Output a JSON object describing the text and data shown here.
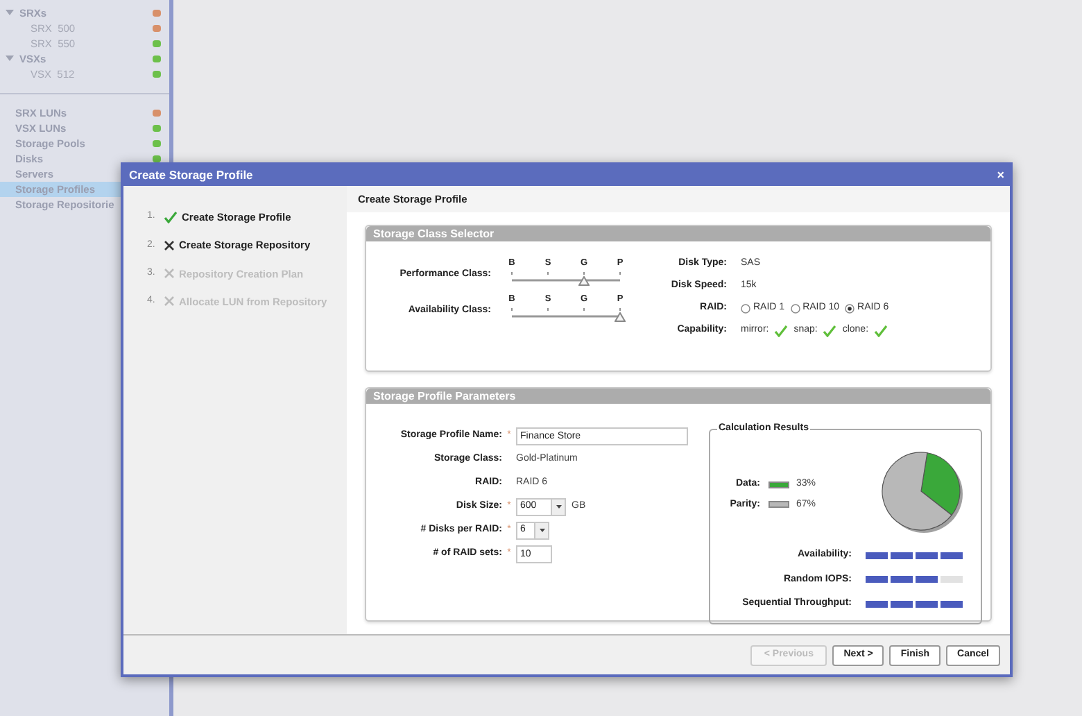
{
  "sidebar": {
    "tree": [
      {
        "label": "SRXs",
        "expanded": true,
        "color": "#d8906a",
        "children": [
          {
            "label": "SRX  500",
            "color": "#d8906a"
          },
          {
            "label": "SRX  550",
            "color": "#6cc04a"
          }
        ]
      },
      {
        "label": "VSXs",
        "expanded": true,
        "color": "#6cc04a",
        "children": [
          {
            "label": "VSX  512",
            "color": "#6cc04a"
          }
        ]
      }
    ],
    "items": [
      {
        "label": "SRX LUNs",
        "color": "#d8906a",
        "selected": false
      },
      {
        "label": "VSX LUNs",
        "color": "#6cc04a",
        "selected": false
      },
      {
        "label": "Storage Pools",
        "color": "#6cc04a",
        "selected": false
      },
      {
        "label": "Disks",
        "color": "#6cc04a",
        "selected": false
      },
      {
        "label": "Servers",
        "selected": false
      },
      {
        "label": "Storage Profiles",
        "selected": true
      },
      {
        "label": "Storage Repositorie",
        "selected": false
      }
    ]
  },
  "dialog": {
    "title": "Create Storage Profile",
    "close": "×",
    "steps": [
      {
        "number": "1.",
        "label": "Create Storage Profile",
        "completed": true,
        "active": false
      },
      {
        "number": "2.",
        "label": "Create Storage Repository",
        "completed": false,
        "active": true
      },
      {
        "number": "3.",
        "label": "Repository Creation Plan",
        "completed": false,
        "active": false
      },
      {
        "number": "4.",
        "label": "Allocate LUN from Repository",
        "completed": false,
        "active": false
      }
    ],
    "heading": "Create Storage Profile",
    "class_selector": {
      "title": "Storage Class Selector",
      "sliders": [
        {
          "label": "Performance Class:",
          "ticks": [
            "B",
            "S",
            "G",
            "P"
          ],
          "level": 0.67
        },
        {
          "label": "Availability Class:",
          "ticks": [
            "B",
            "S",
            "G",
            "P"
          ],
          "level": 1
        }
      ],
      "details": [
        {
          "kind": "text",
          "label": "Disk Type:",
          "value": "SAS"
        },
        {
          "kind": "text",
          "label": "Disk Speed:",
          "value": "15k"
        },
        {
          "kind": "radio",
          "label": "RAID:",
          "options": [
            {
              "label": "RAID 1",
              "selected": false
            },
            {
              "label": "RAID 10",
              "selected": false
            },
            {
              "label": "RAID 6",
              "selected": true
            }
          ]
        },
        {
          "kind": "checks",
          "label": "Capability:",
          "items": [
            {
              "label": "mirror:",
              "checked": true
            },
            {
              "label": "snap:",
              "checked": true
            },
            {
              "label": "clone:",
              "checked": true
            }
          ]
        }
      ]
    },
    "parameters": {
      "title": "Storage Profile Parameters",
      "fields": [
        {
          "kind": "input",
          "label": "Storage Profile Name:",
          "marker": "*",
          "value": "Finance Store"
        },
        {
          "kind": "text",
          "label": "Storage Class:",
          "value": "Gold-Platinum"
        },
        {
          "kind": "text",
          "label": "RAID:",
          "value": "RAID 6"
        },
        {
          "kind": "select",
          "label": "Disk Size:",
          "marker": "*",
          "value": "600",
          "unit": "GB"
        },
        {
          "kind": "select",
          "label": "# Disks per RAID:",
          "marker": "*",
          "value": "6"
        },
        {
          "kind": "small_input",
          "label": "# of RAID sets:",
          "marker": "*",
          "value": "10"
        }
      ],
      "results": {
        "title": "Calculation Results",
        "legend": [
          {
            "label": "Data:",
            "value": "33%",
            "color": "#3aa83a"
          },
          {
            "label": "Parity:",
            "value": "67%",
            "color": "#b8b8b8"
          }
        ],
        "chart_data": {
          "type": "pie",
          "values": [
            33,
            67
          ]
        },
        "meters": [
          {
            "label": "Availability:",
            "level": 1
          },
          {
            "label": "Random IOPS:",
            "level": 0.75
          },
          {
            "label": "Sequential Throughput:",
            "level": 1
          }
        ]
      }
    },
    "buttons": [
      {
        "label": "< Previous",
        "disabled": true
      },
      {
        "label": "Next >",
        "disabled": false
      },
      {
        "label": "Finish",
        "disabled": false
      },
      {
        "label": "Cancel",
        "disabled": false
      }
    ]
  }
}
